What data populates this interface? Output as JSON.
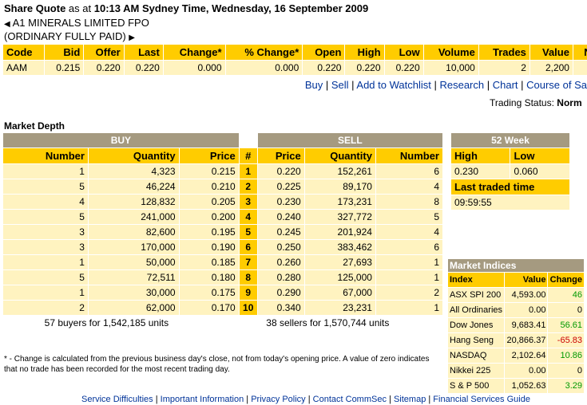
{
  "header": {
    "label": "Share Quote",
    "as_at": "as at",
    "time": "10:13 AM Sydney Time, Wednesday, 16 September 2009"
  },
  "security": {
    "name": "A1 MINERALS LIMITED FPO",
    "type": "(ORDINARY FULLY PAID)"
  },
  "quote": {
    "headers": [
      "Code",
      "Bid",
      "Offer",
      "Last",
      "Change*",
      "% Change*",
      "Open",
      "High",
      "Low",
      "Volume",
      "Trades",
      "Value",
      "New"
    ],
    "row": [
      "AAM",
      "0.215",
      "0.220",
      "0.220",
      "0.000",
      "0.000",
      "0.220",
      "0.220",
      "0.220",
      "10,000",
      "2",
      "2,200",
      ""
    ]
  },
  "links": [
    "Buy",
    "Sell",
    "Add to Watchlist",
    "Research",
    "Chart",
    "Course of Sa"
  ],
  "trading_status": {
    "label": "Trading Status:",
    "value": "Norm"
  },
  "market_depth": {
    "title": "Market Depth",
    "buy_label": "BUY",
    "sell_label": "SELL",
    "headers": [
      "Number",
      "Quantity",
      "Price",
      "#",
      "Price",
      "Quantity",
      "Number"
    ],
    "rows": [
      [
        "1",
        "4,323",
        "0.215",
        "1",
        "0.220",
        "152,261",
        "6"
      ],
      [
        "5",
        "46,224",
        "0.210",
        "2",
        "0.225",
        "89,170",
        "4"
      ],
      [
        "4",
        "128,832",
        "0.205",
        "3",
        "0.230",
        "173,231",
        "8"
      ],
      [
        "5",
        "241,000",
        "0.200",
        "4",
        "0.240",
        "327,772",
        "5"
      ],
      [
        "3",
        "82,600",
        "0.195",
        "5",
        "0.245",
        "201,924",
        "4"
      ],
      [
        "3",
        "170,000",
        "0.190",
        "6",
        "0.250",
        "383,462",
        "6"
      ],
      [
        "1",
        "50,000",
        "0.185",
        "7",
        "0.260",
        "27,693",
        "1"
      ],
      [
        "5",
        "72,511",
        "0.180",
        "8",
        "0.280",
        "125,000",
        "1"
      ],
      [
        "1",
        "30,000",
        "0.175",
        "9",
        "0.290",
        "67,000",
        "2"
      ],
      [
        "2",
        "62,000",
        "0.170",
        "10",
        "0.340",
        "23,231",
        "1"
      ]
    ],
    "buy_summary": "57 buyers for 1,542,185 units",
    "sell_summary": "38 sellers for 1,570,744 units"
  },
  "week52": {
    "title": "52 Week",
    "high_label": "High",
    "low_label": "Low",
    "high": "0.230",
    "low": "0.060",
    "last_traded_label": "Last traded time",
    "last_traded": "09:59:55"
  },
  "indices": {
    "title": "Market Indices",
    "headers": [
      "Index",
      "Value",
      "Change"
    ],
    "rows": [
      {
        "name": "ASX SPI 200",
        "value": "4,593.00",
        "change": "46",
        "dir": "up"
      },
      {
        "name": "All Ordinaries",
        "value": "0.00",
        "change": "0",
        "dir": "none"
      },
      {
        "name": "Dow Jones",
        "value": "9,683.41",
        "change": "56.61",
        "dir": "up"
      },
      {
        "name": "Hang Seng",
        "value": "20,866.37",
        "change": "-65.83",
        "dir": "down"
      },
      {
        "name": "NASDAQ",
        "value": "2,102.64",
        "change": "10.86",
        "dir": "up"
      },
      {
        "name": "Nikkei 225",
        "value": "0.00",
        "change": "0",
        "dir": "none"
      },
      {
        "name": "S & P 500",
        "value": "1,052.63",
        "change": "3.29",
        "dir": "up"
      }
    ]
  },
  "note": "* - Change is calculated from the previous business day's close, not from today's opening price. A value of zero indicates that no trade has been recorded for the most recent trading day.",
  "footer": [
    "Service Difficulties",
    "Important Information",
    "Privacy Policy",
    "Contact CommSec",
    "Sitemap",
    "Financial Services Guide"
  ],
  "colors": {
    "header_gold": "#ffcc00",
    "row_cream": "#fff3c0",
    "group_taupe": "#a59a80",
    "link_blue": "#003399",
    "up": "#009900",
    "down": "#cc0000"
  }
}
